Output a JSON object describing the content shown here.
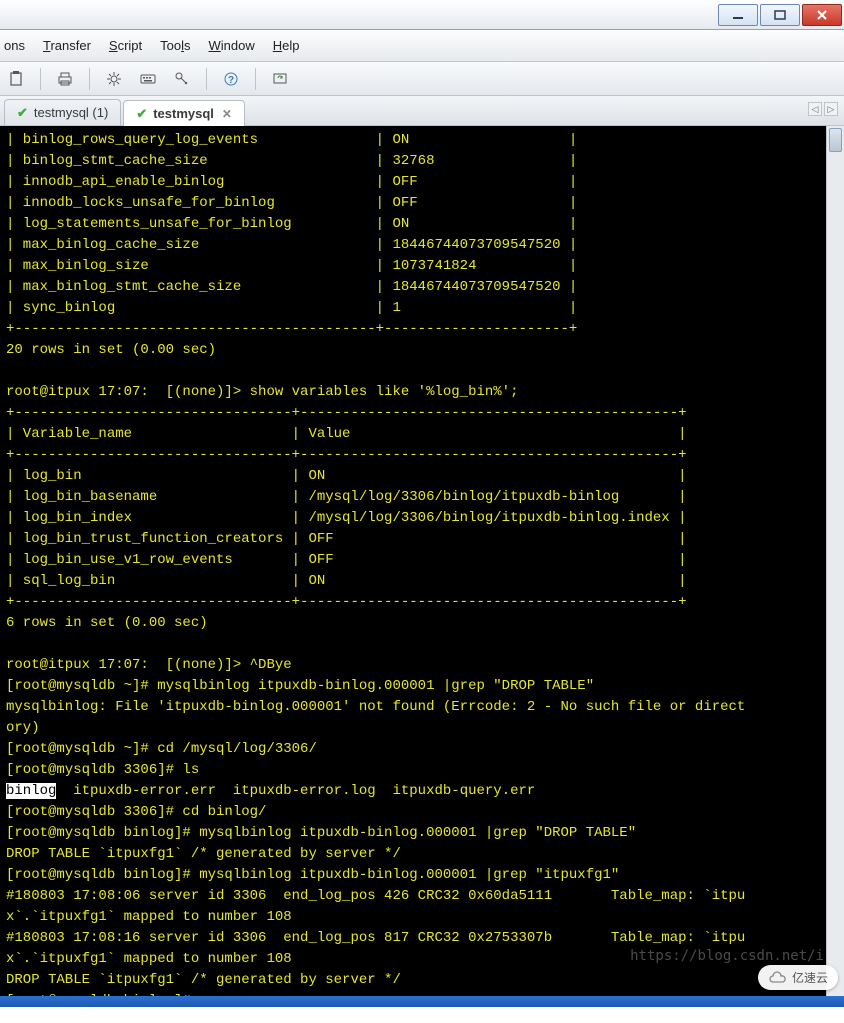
{
  "menu": {
    "m1": "ons",
    "m2_pre": "T",
    "m2_rest": "ransfer",
    "m3_pre": "S",
    "m3_rest": "cript",
    "m4": "Too",
    "m4_u": "l",
    "m4_rest": "s",
    "m5_pre": "W",
    "m5_rest": "indow",
    "m6_pre": "H",
    "m6_rest": "elp"
  },
  "tabs": {
    "t1": "testmysql (1)",
    "t2": "testmysql"
  },
  "terminal": {
    "lines": [
      "| binlog_rows_query_log_events              | ON                   |",
      "| binlog_stmt_cache_size                    | 32768                |",
      "| innodb_api_enable_binlog                  | OFF                  |",
      "| innodb_locks_unsafe_for_binlog            | OFF                  |",
      "| log_statements_unsafe_for_binlog          | ON                   |",
      "| max_binlog_cache_size                     | 18446744073709547520 |",
      "| max_binlog_size                           | 1073741824           |",
      "| max_binlog_stmt_cache_size                | 18446744073709547520 |",
      "| sync_binlog                               | 1                    |",
      "+-------------------------------------------+----------------------+",
      "20 rows in set (0.00 sec)",
      "",
      "root@itpux 17:07:  [(none)]> show variables like '%log_bin%';",
      "+---------------------------------+---------------------------------------------+",
      "| Variable_name                   | Value                                       |",
      "+---------------------------------+---------------------------------------------+",
      "| log_bin                         | ON                                          |",
      "| log_bin_basename                | /mysql/log/3306/binlog/itpuxdb-binlog       |",
      "| log_bin_index                   | /mysql/log/3306/binlog/itpuxdb-binlog.index |",
      "| log_bin_trust_function_creators | OFF                                         |",
      "| log_bin_use_v1_row_events       | OFF                                         |",
      "| sql_log_bin                     | ON                                          |",
      "+---------------------------------+---------------------------------------------+",
      "6 rows in set (0.00 sec)",
      "",
      "root@itpux 17:07:  [(none)]> ^DBye",
      "[root@mysqldb ~]# mysqlbinlog itpuxdb-binlog.000001 |grep \"DROP TABLE\"",
      "mysqlbinlog: File 'itpuxdb-binlog.000001' not found (Errcode: 2 - No such file or direct",
      "ory)",
      "[root@mysqldb ~]# cd /mysql/log/3306/",
      "[root@mysqldb 3306]# ls"
    ],
    "line_sel": "binlog",
    "line_sel_rest": "  itpuxdb-error.err  itpuxdb-error.log  itpuxdb-query.err",
    "lines2": [
      "[root@mysqldb 3306]# cd binlog/",
      "[root@mysqldb binlog]# mysqlbinlog itpuxdb-binlog.000001 |grep \"DROP TABLE\"",
      "DROP TABLE `itpuxfg1` /* generated by server */",
      "[root@mysqldb binlog]# mysqlbinlog itpuxdb-binlog.000001 |grep \"itpuxfg1\"",
      "#180803 17:08:06 server id 3306  end_log_pos 426 CRC32 0x60da5111       Table_map: `itpu",
      "x`.`itpuxfg1` mapped to number 108",
      "#180803 17:08:16 server id 3306  end_log_pos 817 CRC32 0x2753307b       Table_map: `itpu",
      "x`.`itpuxfg1` mapped to number 108",
      "DROP TABLE `itpuxfg1` /* generated by server */",
      "[root@mysqldb binlog]# "
    ]
  },
  "watermark": "https://blog.csdn.net/i",
  "cloud": "亿速云",
  "colors": {
    "term_bg": "#000000",
    "term_fg": "#e6e62b"
  }
}
